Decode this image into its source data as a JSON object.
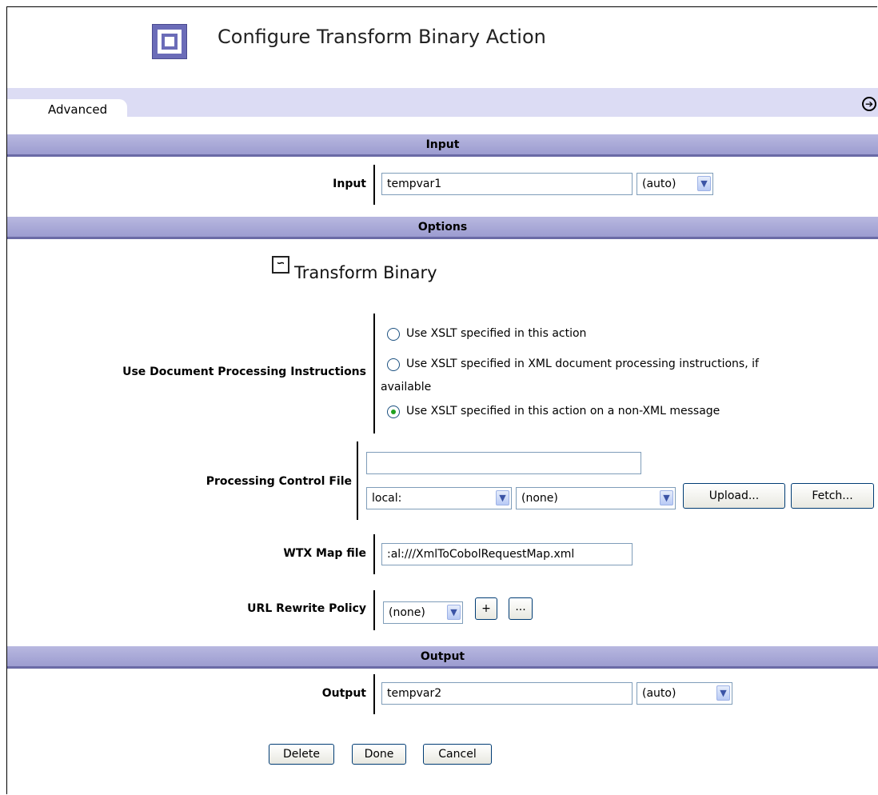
{
  "header": {
    "title": "Configure Transform Binary Action"
  },
  "advanced": {
    "label": "Advanced"
  },
  "sections": {
    "input": "Input",
    "options": "Options",
    "output": "Output"
  },
  "input_row": {
    "label": "Input",
    "value": "tempvar1",
    "context": "(auto)"
  },
  "options": {
    "tool_title": "Transform Binary",
    "doc_processing": {
      "label": "Use Document Processing Instructions",
      "options": [
        {
          "line1": "Use XSLT specified in this action",
          "selected": false
        },
        {
          "line1": "Use XSLT specified in XML document processing instructions, if",
          "line2": "available",
          "selected": false
        },
        {
          "line1": "Use XSLT specified in this action on a non-XML message",
          "selected": true
        }
      ]
    },
    "processing_control_file": {
      "label": "Processing Control File",
      "value": "",
      "location": "local:",
      "file": "(none)",
      "upload": "Upload...",
      "fetch": "Fetch..."
    },
    "wtx_map": {
      "label": "WTX Map file",
      "value": ":al:///XmlToCobolRequestMap.xml"
    },
    "url_rewrite": {
      "label": "URL Rewrite Policy",
      "value": "(none)",
      "add": "+",
      "edit": "..."
    }
  },
  "output_row": {
    "label": "Output",
    "value": "tempvar2",
    "context": "(auto)"
  },
  "buttons": {
    "delete": "Delete",
    "done": "Done",
    "cancel": "Cancel"
  },
  "colors": {
    "section": "#9c9cd0",
    "band": "#dcdcf4",
    "logo": "#6b6cb8"
  }
}
